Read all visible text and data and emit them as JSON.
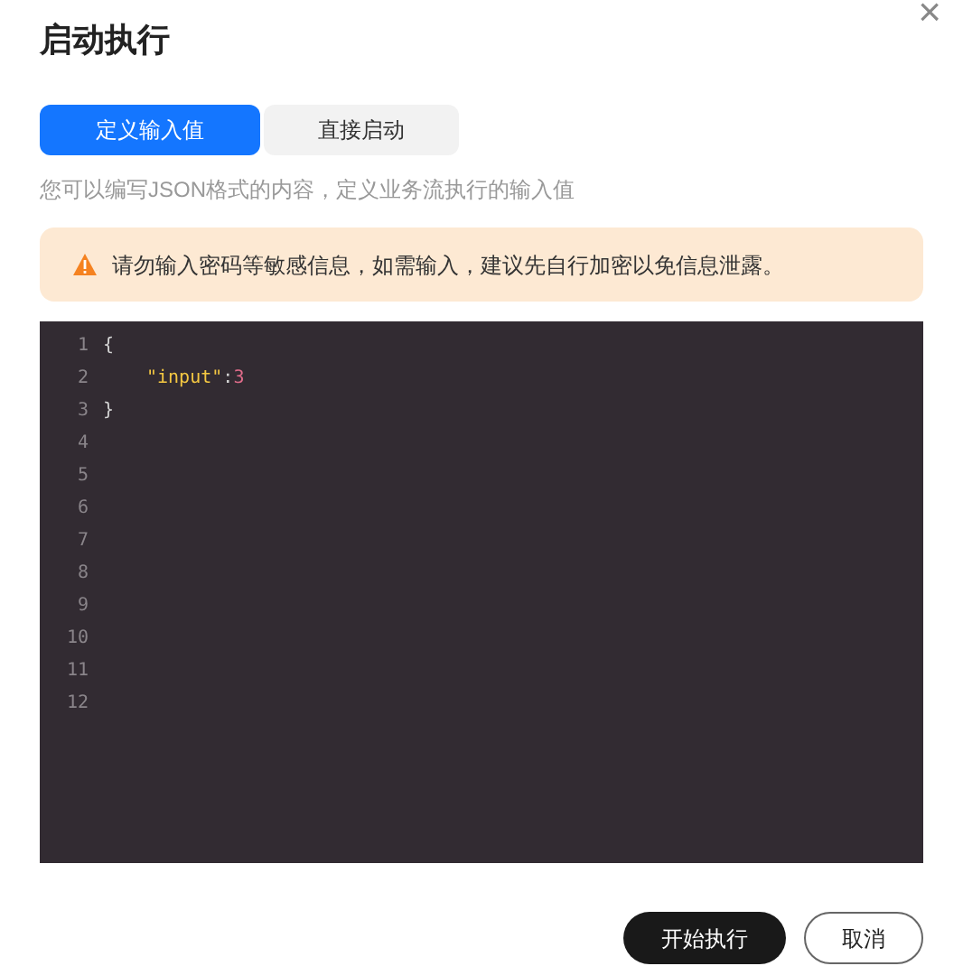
{
  "dialog": {
    "title": "启动执行",
    "close": "×"
  },
  "tabs": [
    {
      "label": "定义输入值",
      "selected": true
    },
    {
      "label": "直接启动",
      "selected": false
    }
  ],
  "description": "您可以编写JSON格式的内容，定义业务流执行的输入值",
  "warning": {
    "text": "请勿输入密码等敏感信息，如需输入，建议先自行加密以免信息泄露。"
  },
  "editor": {
    "line_numbers": [
      "1",
      "2",
      "3",
      "4",
      "5",
      "6",
      "7",
      "8",
      "9",
      "10",
      "11",
      "12"
    ],
    "lines": [
      [
        {
          "kind": "punct",
          "text": "{"
        }
      ],
      [
        {
          "kind": "indent"
        },
        {
          "kind": "key",
          "text": "\"input\""
        },
        {
          "kind": "punct",
          "text": ":"
        },
        {
          "kind": "number",
          "text": "3"
        }
      ],
      [
        {
          "kind": "punct",
          "text": "}"
        }
      ]
    ]
  },
  "buttons": [
    {
      "label": "开始执行",
      "kind": "primary"
    },
    {
      "label": "取消",
      "kind": "secondary"
    }
  ]
}
